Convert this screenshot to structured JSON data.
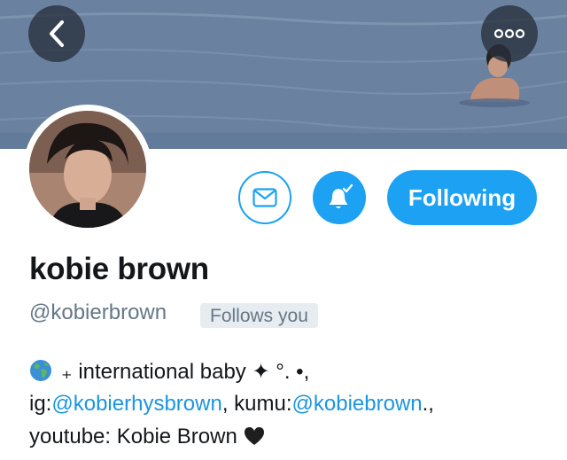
{
  "profile": {
    "name": "kobie brown",
    "handle": "@kobierbrown",
    "follows_you": "Follows you",
    "following_label": "Following"
  },
  "bio": {
    "line1": "₊ international baby ✦ °. •,",
    "ig_prefix": "ig:",
    "ig_link": "@kobierhysbrown",
    "kumu_prefix": ", kumu:",
    "kumu_link": "@kobiebrown",
    "kumu_suffix": ".,",
    "line3": "youtube: Kobie Brown"
  },
  "icons": {
    "back": "chevron-left-icon",
    "more": "more-dots-icon",
    "message": "envelope-icon",
    "notifications": "bell-check-icon",
    "globe": "globe-emoji-icon",
    "heart": "black-heart-icon"
  },
  "colors": {
    "accent": "#1da1f2",
    "link": "#1b95e0",
    "muted": "#657786",
    "badge_bg": "#e6ecf0"
  }
}
